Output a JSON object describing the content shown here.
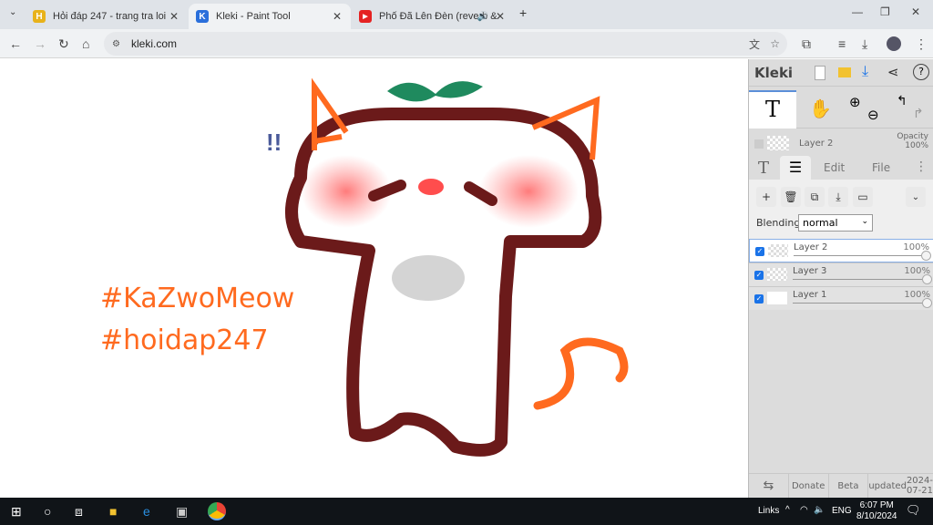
{
  "browser": {
    "tabs": [
      {
        "title": "Hỏi đáp 247 - trang tra loi",
        "favicon": "H",
        "color": "#e8b21a"
      },
      {
        "title": "Kleki - Paint Tool",
        "favicon": "K",
        "color": "#2a6fdb"
      },
      {
        "title": "Phố Đã Lên Đèn (reverb & ",
        "favicon": "▶",
        "color": "#e52222"
      }
    ],
    "url": "kleki.com"
  },
  "artwork": {
    "text_lines": [
      "#KaZwoMeow",
      "#hoidap247"
    ],
    "exclaim": "!!",
    "accent": "#ff6a1f",
    "outline": "#6b1a1a"
  },
  "panel": {
    "logo": "Kleki",
    "current_layer": "Layer 2",
    "opacity_label": "Opacity",
    "opacity_value": "100%",
    "tabs": {
      "edit": "Edit",
      "file": "File"
    },
    "blending_label": "Blending",
    "blending_value": "normal",
    "layers": [
      {
        "name": "Layer 2",
        "opacity": "100%"
      },
      {
        "name": "Layer 3",
        "opacity": "100%"
      },
      {
        "name": "Layer 1",
        "opacity": "100%"
      }
    ],
    "footer": {
      "donate": "Donate",
      "beta": "Beta",
      "updated": "updated",
      "date": "2024-07-21"
    }
  },
  "taskbar": {
    "links": "Links",
    "lang": "ENG",
    "time": "6:07 PM",
    "date": "8/10/2024"
  }
}
